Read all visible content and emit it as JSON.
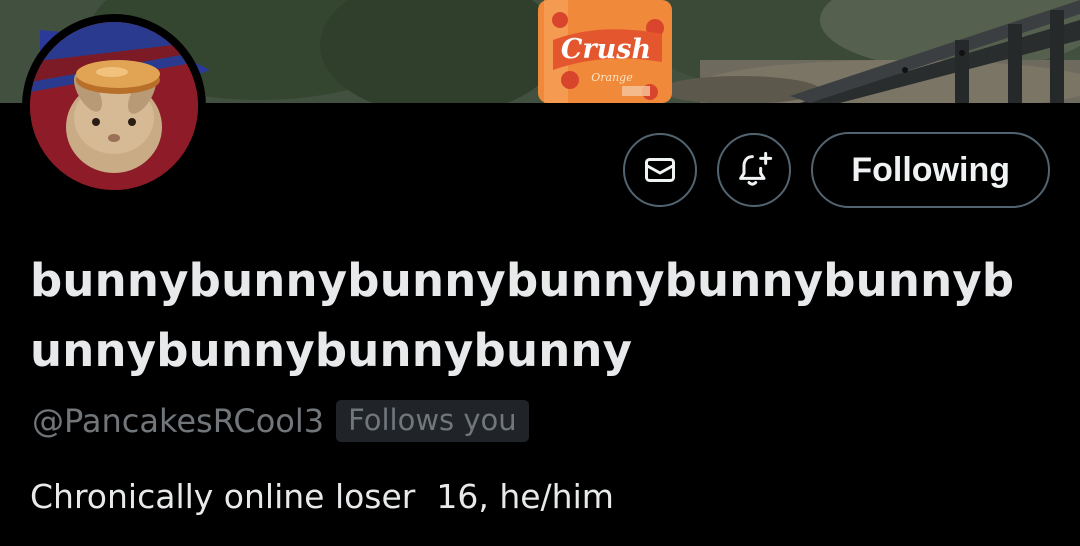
{
  "banner": {
    "bottle_brand": "Crush",
    "bottle_flavor": "Orange"
  },
  "actions": {
    "message_icon": "envelope-icon",
    "notify_icon": "bell-plus-icon",
    "follow_label": "Following"
  },
  "profile": {
    "display_name": "bunnybunnybunnybunnybunnybunnybunnybunnybunnybunny",
    "handle": "@PancakesRCool3",
    "follows_you_badge": "Follows you",
    "bio": "Chronically online loser  16, he/him"
  },
  "colors": {
    "background": "#000000",
    "text_primary": "#e7e9ea",
    "text_secondary": "#71767b",
    "border": "#536471",
    "badge_bg": "#202327"
  }
}
